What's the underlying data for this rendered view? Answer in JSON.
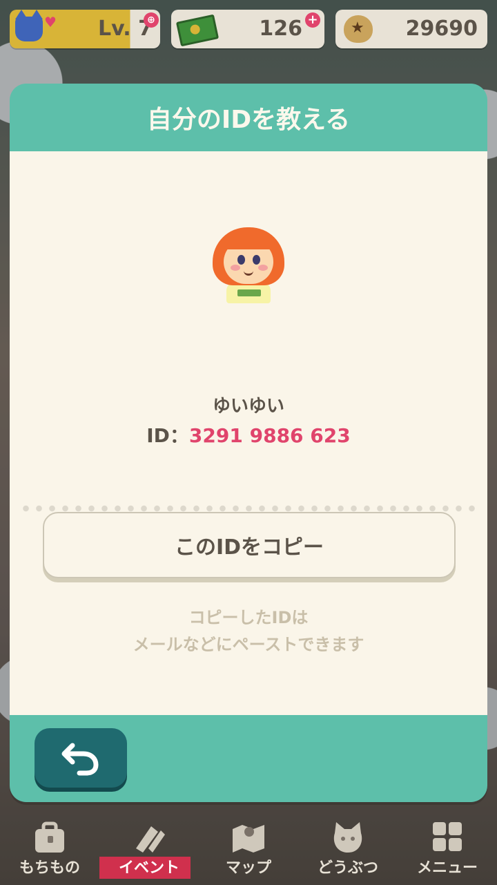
{
  "hud": {
    "level_label": "Lv. 7",
    "tickets": "126",
    "bells": "29690"
  },
  "dialog": {
    "title": "自分のIDを教える",
    "player_name": "ゆいゆい",
    "id_label": "ID：",
    "id_value": "3291 9886 623",
    "copy_button": "このIDをコピー",
    "note_line1": "コピーしたIDは",
    "note_line2": "メールなどにペーストできます"
  },
  "nav": {
    "items": [
      {
        "label": "もちもの",
        "icon": "bag-icon"
      },
      {
        "label": "イベント",
        "icon": "event-icon"
      },
      {
        "label": "マップ",
        "icon": "map-icon"
      },
      {
        "label": "どうぶつ",
        "icon": "cat-face-icon"
      },
      {
        "label": "メニュー",
        "icon": "menu-grid-icon"
      }
    ]
  },
  "colors": {
    "teal": "#5dbfaa",
    "cream": "#faf5e9",
    "id_pink": "#e0446c",
    "back_button": "#1f6a6f"
  }
}
